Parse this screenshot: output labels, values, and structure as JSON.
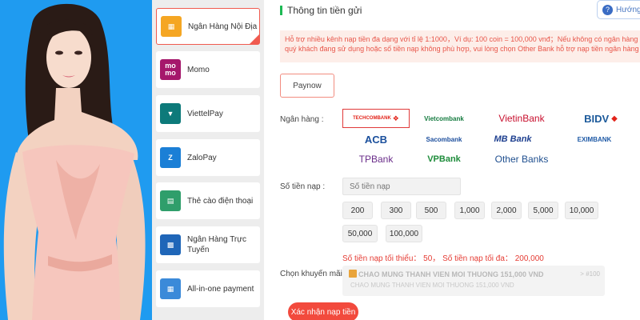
{
  "sidebar": {
    "items": [
      {
        "label": "Ngân Hàng Nội Địa",
        "icon": "bank-card-icon",
        "color": "#f5a623"
      },
      {
        "label": "Momo",
        "icon": "momo-icon",
        "color": "#a5176b"
      },
      {
        "label": "ViettelPay",
        "icon": "viettelpay-icon",
        "color": "#0d7a7a"
      },
      {
        "label": "ZaloPay",
        "icon": "zalopay-icon",
        "color": "#1b7fd6"
      },
      {
        "label": "Thẻ cào điện thoại",
        "icon": "scratch-card-icon",
        "color": "#2f9e6b"
      },
      {
        "label": "Ngân Hàng Trực Tuyến",
        "icon": "online-bank-icon",
        "color": "#1f66b8"
      },
      {
        "label": "All-in-one payment",
        "icon": "all-in-one-icon",
        "color": "#3b8ad9"
      }
    ]
  },
  "main": {
    "section_title": "Thông tin tiền gửi",
    "guide_label": "Hướng",
    "notice": "Hỗ trợ nhiều kênh nạp tiền đa dạng với tỉ lệ 1:1000，Ví dụ: 100 coin = 100,000 vnđ；Nếu không có ngân hàng quý khách đang sử dụng hoặc số tiền nạp không phù hợp, vui lòng chọn Other Bank hỗ trợ nạp tiền ngân hàng",
    "paynow_label": "Paynow",
    "bank_label": "Ngân hàng :",
    "banks": [
      {
        "name": "TECHCOMBANK",
        "color": "#e2231a"
      },
      {
        "name": "Vietcombank",
        "color": "#137a3e"
      },
      {
        "name": "VietinBank",
        "color": "#c8102e"
      },
      {
        "name": "BIDV",
        "color": "#1c5a9b"
      },
      {
        "name": "ACB",
        "color": "#1a4f9c"
      },
      {
        "name": "Sacombank",
        "color": "#1c4e9d"
      },
      {
        "name": "MB Bank",
        "color": "#1d3f8f"
      },
      {
        "name": "EXIMBANK",
        "color": "#1f5aa6"
      },
      {
        "name": "TPBank",
        "color": "#6a2d8a"
      },
      {
        "name": "VPBank",
        "color": "#1e8c3b"
      },
      {
        "name": "Other Banks",
        "color": "#1f4f8f"
      }
    ],
    "amount_label": "Số tiền nạp :",
    "amount_placeholder": "Số tiền nạp",
    "amounts": [
      "200",
      "300",
      "500",
      "1,000",
      "2,000",
      "5,000",
      "10,000",
      "50,000",
      "100,000"
    ],
    "limits": "Số tiền nạp tối thiểu： 50，  Số tiền nạp tối đa： 200,000",
    "promo_label": "Chọn khuyến mãi :",
    "promo_title": "CHAO MUNG THANH VIEN MOI THUONG 151,000 VND",
    "promo_sub": "CHAO MUNG THANH VIEN MOI THUONG 151,000 VND",
    "promo_badge": "> #100",
    "confirm_label": "Xác nhận nạp tiền"
  },
  "colors": {
    "accent": "#f24a3d",
    "hero_bg": "#1f9bf0",
    "green_bar": "#1db954"
  }
}
